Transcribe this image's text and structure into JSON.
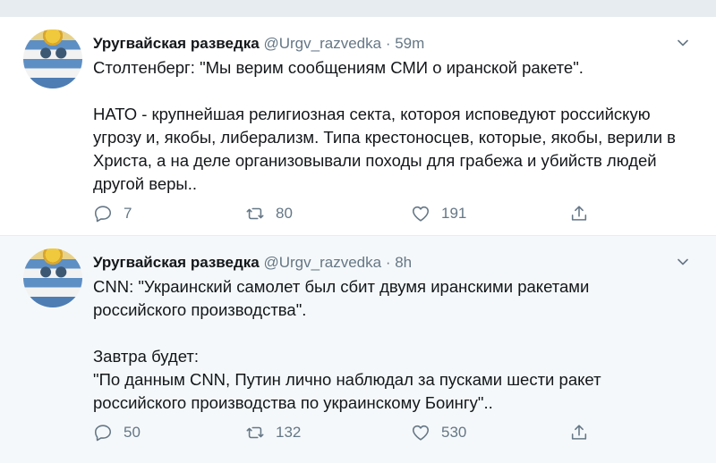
{
  "tweets": [
    {
      "name": "Уругвайская разведка",
      "handle": "@Urgv_razvedka",
      "dot": "·",
      "time": "59m",
      "paragraphs": [
        "Столтенберг: \"Мы верим сообщениям СМИ о иранской ракете\".",
        "НАТО - крупнейшая религиозная секта, котороя исповедуют российскую угрозу и, якобы, либерализм. Типа крестоносцев, которые, якобы, верили в Христа, а на деле организовывали походы для грабежа и убийств людей другой веры.."
      ],
      "replies": "7",
      "retweets": "80",
      "likes": "191"
    },
    {
      "name": "Уругвайская разведка",
      "handle": "@Urgv_razvedka",
      "dot": "·",
      "time": "8h",
      "paragraphs": [
        "CNN: \"Украинский самолет был сбит двумя иранскими ракетами российского производства\".",
        "Завтра будет:\n\"По данным CNN, Путин лично наблюдал за пусками шести ракет российского производства по украинскому Боингу\".."
      ],
      "replies": "50",
      "retweets": "132",
      "likes": "530"
    }
  ],
  "icons": {
    "reply": "reply-icon",
    "retweet": "retweet-icon",
    "like": "heart-icon",
    "share": "share-icon",
    "caret": "chevron-down-icon"
  },
  "colors": {
    "name": "#14171a",
    "muted": "#657786",
    "background": "#e6ecf0",
    "tweet_bg": "#ffffff"
  }
}
